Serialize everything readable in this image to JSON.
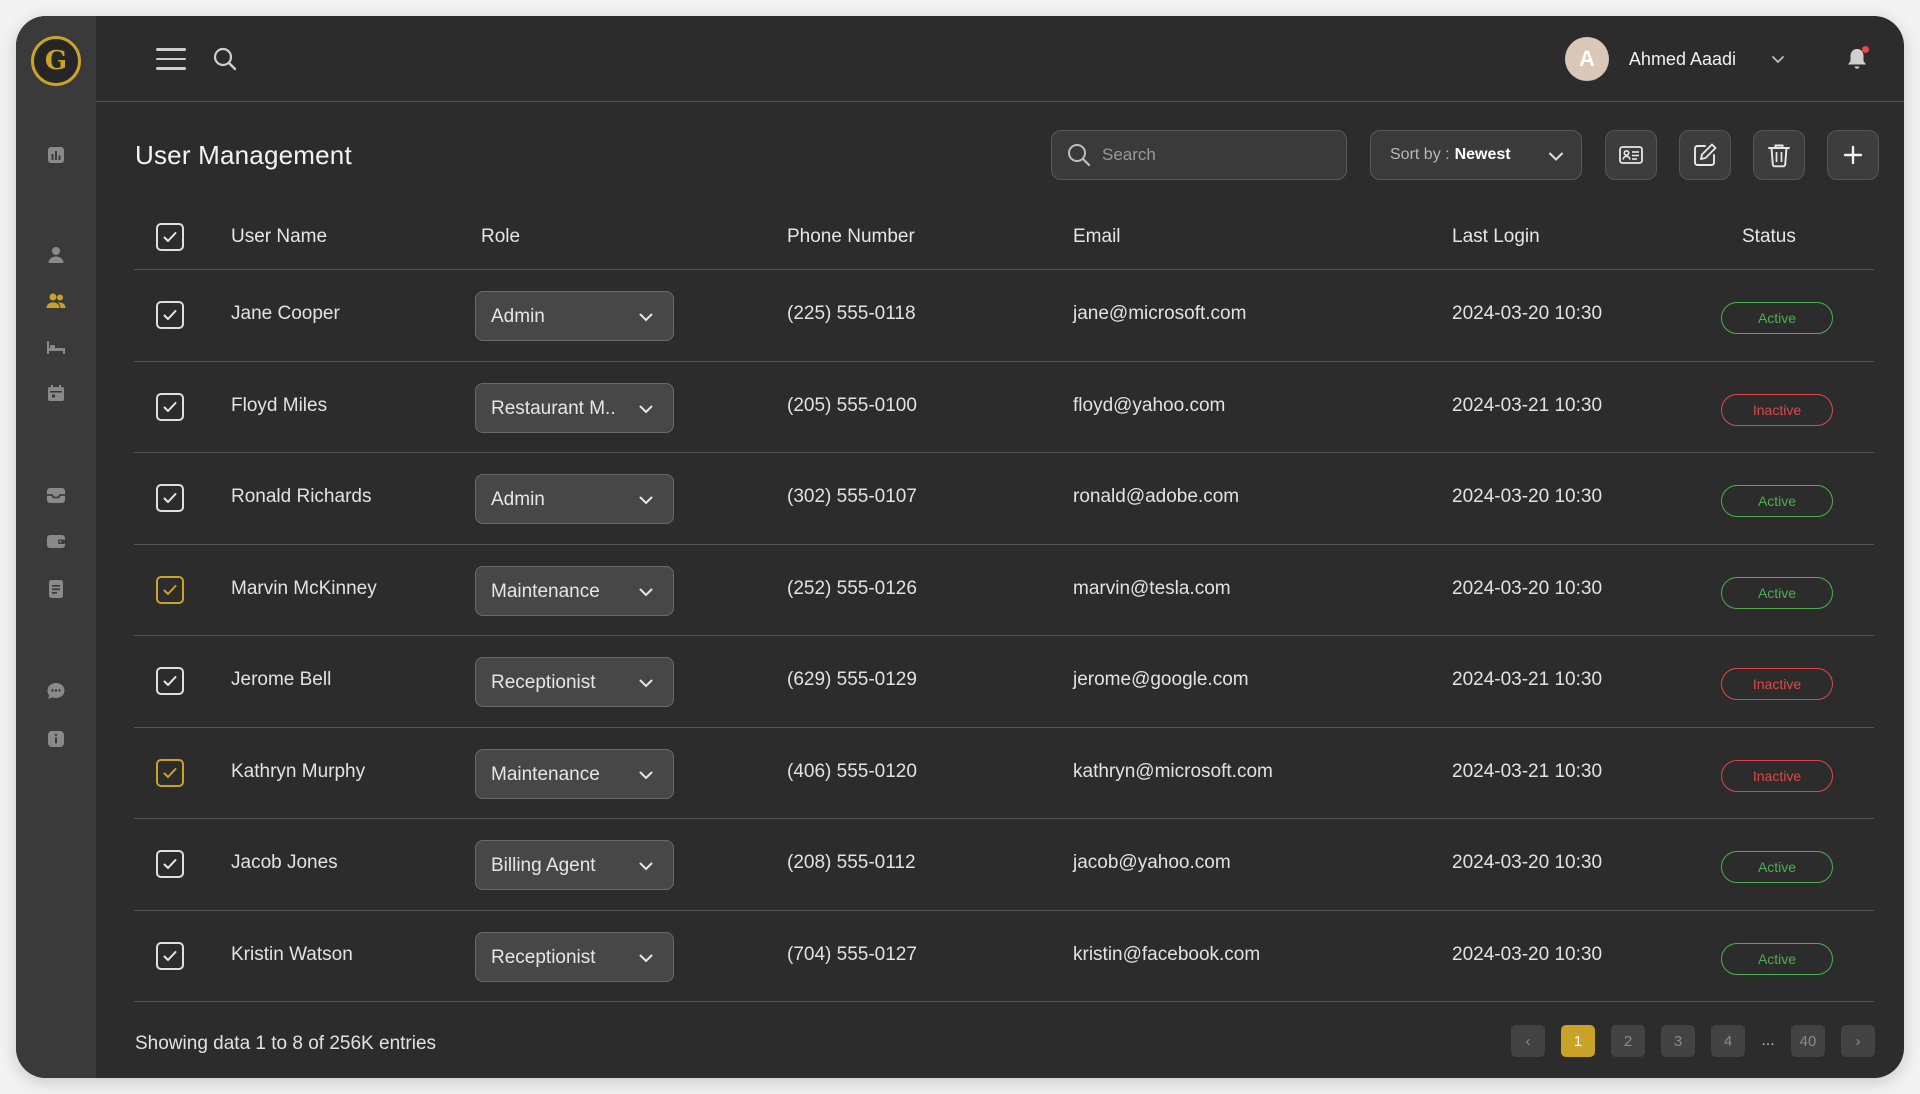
{
  "brand": {
    "logo_letter": "G",
    "accent": "#c9a227"
  },
  "sidebar": {
    "items": [
      {
        "icon": "chart-icon"
      },
      {
        "icon": "user-icon"
      },
      {
        "icon": "users-icon",
        "active": true
      },
      {
        "icon": "bed-icon"
      },
      {
        "icon": "calendar-icon"
      },
      {
        "icon": "inbox-icon"
      },
      {
        "icon": "wallet-icon"
      },
      {
        "icon": "document-icon"
      },
      {
        "icon": "chat-icon"
      },
      {
        "icon": "info-icon"
      }
    ]
  },
  "header": {
    "user": {
      "initial": "A",
      "name": "Ahmed Aaadi"
    }
  },
  "page": {
    "title": "User Management",
    "search_placeholder": "Search",
    "sort_label": "Sort by :",
    "sort_value": "Newest"
  },
  "table": {
    "columns": [
      "User Name",
      "Role",
      "Phone Number",
      "Email",
      "Last Login",
      "Status"
    ],
    "rows": [
      {
        "name": "Jane Cooper",
        "role": "Admin",
        "phone": "(225) 555-0118",
        "email": "jane@microsoft.com",
        "last_login": "2024-03-20 10:30",
        "status": "Active",
        "check_style": "white"
      },
      {
        "name": "Floyd Miles",
        "role": "Restaurant M..",
        "phone": "(205) 555-0100",
        "email": "floyd@yahoo.com",
        "last_login": "2024-03-21 10:30",
        "status": "Inactive",
        "check_style": "white"
      },
      {
        "name": "Ronald Richards",
        "role": "Admin",
        "phone": "(302) 555-0107",
        "email": "ronald@adobe.com",
        "last_login": "2024-03-20 10:30",
        "status": "Active",
        "check_style": "white"
      },
      {
        "name": "Marvin McKinney",
        "role": "Maintenance",
        "phone": "(252) 555-0126",
        "email": "marvin@tesla.com",
        "last_login": "2024-03-20 10:30",
        "status": "Active",
        "check_style": "gold"
      },
      {
        "name": "Jerome Bell",
        "role": "Receptionist",
        "phone": "(629) 555-0129",
        "email": "jerome@google.com",
        "last_login": "2024-03-21 10:30",
        "status": "Inactive",
        "check_style": "white"
      },
      {
        "name": "Kathryn Murphy",
        "role": "Maintenance",
        "phone": "(406) 555-0120",
        "email": "kathryn@microsoft.com",
        "last_login": "2024-03-21 10:30",
        "status": "Inactive",
        "check_style": "gold"
      },
      {
        "name": "Jacob Jones",
        "role": "Billing Agent",
        "phone": "(208) 555-0112",
        "email": "jacob@yahoo.com",
        "last_login": "2024-03-20 10:30",
        "status": "Active",
        "check_style": "white"
      },
      {
        "name": "Kristin Watson",
        "role": "Receptionist",
        "phone": "(704) 555-0127",
        "email": "kristin@facebook.com",
        "last_login": "2024-03-20 10:30",
        "status": "Active",
        "check_style": "white"
      }
    ]
  },
  "footer": {
    "showing_text": "Showing data 1 to 8 of  256K entries",
    "pages": [
      "1",
      "2",
      "3",
      "4",
      "40"
    ],
    "current_page": "1",
    "ellipsis": "...",
    "prev": "‹",
    "next": "›"
  },
  "colors": {
    "active": "#4caf50",
    "inactive": "#e04848"
  }
}
